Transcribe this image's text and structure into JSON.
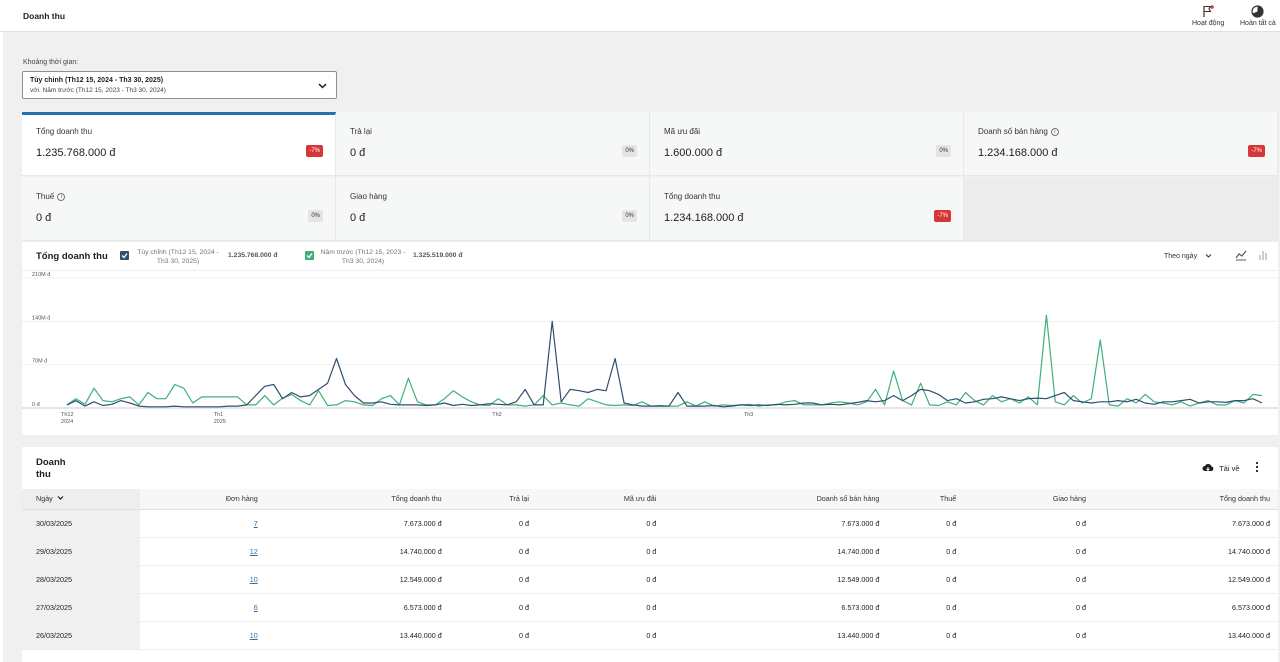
{
  "header": {
    "title": "Doanh thu",
    "activity_label": "Hoạt động",
    "finish_label": "Hoàn tất cà"
  },
  "period": {
    "label": "Khoảng thời gian:",
    "current": "Tùy chỉnh (Th12 15, 2024 - Th3 30, 2025)",
    "compare": "với. Năm trước (Th12 15, 2023 - Th3 30, 2024)"
  },
  "metrics": [
    {
      "label": "Tổng doanh thu",
      "value": "1.235.768.000 đ",
      "delta": "-7%",
      "trend": "neg",
      "active": true,
      "info": false
    },
    {
      "label": "Trả lại",
      "value": "0 đ",
      "delta": "0%",
      "trend": "zero",
      "active": false,
      "info": false
    },
    {
      "label": "Mã ưu đãi",
      "value": "1.600.000 đ",
      "delta": "0%",
      "trend": "zero",
      "active": false,
      "info": false
    },
    {
      "label": "Doanh số bán hàng",
      "value": "1.234.168.000 đ",
      "delta": "-7%",
      "trend": "neg",
      "active": false,
      "info": true
    },
    {
      "label": "Thuế",
      "value": "0 đ",
      "delta": "0%",
      "trend": "zero",
      "active": false,
      "info": true
    },
    {
      "label": "Giao hàng",
      "value": "0 đ",
      "delta": "0%",
      "trend": "zero",
      "active": false,
      "info": false
    },
    {
      "label": "Tổng doanh thu",
      "value": "1.234.168.000 đ",
      "delta": "-7%",
      "trend": "neg",
      "active": false,
      "info": false
    }
  ],
  "chart": {
    "title": "Tổng doanh thu",
    "legend": [
      {
        "name": "Tùy chỉnh (Th12 15, 2024 - Th3 30, 2025)",
        "amount": "1.235.768.000 đ",
        "color": "#2f4f6f"
      },
      {
        "name": "Năm trước (Th12 15, 2023 - Th3 30, 2024)",
        "amount": "1.325.519.000 đ",
        "color": "#40b07a"
      }
    ],
    "interval_label": "Theo ngày"
  },
  "chart_data": {
    "type": "line",
    "y_ticks": [
      "210M đ",
      "140M đ",
      "70M đ",
      "0 đ"
    ],
    "ylim": [
      0,
      210
    ],
    "x_ticks": [
      {
        "line1": "Th12",
        "line2": "2024",
        "day": 0
      },
      {
        "line1": "Th1",
        "line2": "2025",
        "day": 17
      },
      {
        "line1": "Th2",
        "line2": "",
        "day": 48
      },
      {
        "line1": "Th3",
        "line2": "",
        "day": 76
      }
    ],
    "grid": true,
    "series": [
      {
        "name": "Tùy chỉnh (Th12 15, 2024 - Th3 30, 2025)",
        "color": "#2f4f6f",
        "values": [
          5,
          12,
          3,
          10,
          4,
          6,
          12,
          8,
          3,
          2,
          2,
          2,
          3,
          2,
          2,
          2,
          2,
          2,
          3,
          3,
          5,
          20,
          35,
          38,
          15,
          25,
          18,
          20,
          30,
          40,
          80,
          38,
          20,
          8,
          8,
          10,
          6,
          5,
          5,
          5,
          4,
          5,
          8,
          4,
          6,
          4,
          5,
          7,
          6,
          5,
          10,
          30,
          5,
          5,
          140,
          10,
          30,
          28,
          25,
          30,
          28,
          80,
          8,
          5,
          3,
          3,
          3,
          3,
          25,
          3,
          3,
          3,
          4,
          2,
          3,
          5,
          4,
          5,
          4,
          6,
          5,
          6,
          8,
          8,
          5,
          6,
          5,
          7,
          9,
          12,
          10,
          12,
          20,
          12,
          20,
          30,
          28,
          22,
          12,
          15,
          8,
          10,
          14,
          15,
          18,
          15,
          12,
          15,
          16,
          15,
          20,
          25,
          12,
          10,
          8,
          10,
          10,
          12,
          10,
          14,
          8,
          6,
          10,
          10,
          12,
          14,
          8,
          10,
          10,
          9,
          12,
          12,
          15,
          8
        ]
      },
      {
        "name": "Năm trước (Th12 15, 2023 - Th3 30, 2024)",
        "color": "#40b07a",
        "values": [
          5,
          15,
          6,
          32,
          12,
          10,
          15,
          18,
          5,
          25,
          15,
          15,
          38,
          32,
          8,
          18,
          18,
          18,
          18,
          18,
          5,
          5,
          20,
          5,
          16,
          22,
          12,
          5,
          28,
          4,
          5,
          12,
          10,
          5,
          4,
          15,
          20,
          5,
          48,
          10,
          5,
          5,
          15,
          28,
          18,
          10,
          5,
          4,
          15,
          5,
          5,
          3,
          5,
          20,
          5,
          8,
          5,
          3,
          15,
          10,
          5,
          4,
          5,
          4,
          10,
          3,
          4,
          3,
          3,
          10,
          3,
          10,
          3,
          5,
          4,
          5,
          6,
          3,
          5,
          5,
          10,
          12,
          5,
          5,
          5,
          8,
          10,
          8,
          5,
          10,
          30,
          5,
          60,
          12,
          5,
          40,
          5,
          4,
          10,
          5,
          25,
          12,
          5,
          20,
          10,
          15,
          8,
          18,
          5,
          150,
          10,
          5,
          20,
          8,
          15,
          110,
          5,
          3,
          15,
          8,
          22,
          10,
          8,
          5,
          10,
          3,
          8,
          12,
          5,
          5,
          12,
          8,
          22,
          20
        ]
      }
    ]
  },
  "table": {
    "title": "Doanh thu",
    "download_label": "Tải về",
    "headers": [
      "Ngày",
      "Đơn hàng",
      "Tổng doanh thu",
      "Trả lại",
      "Mã ưu đãi",
      "Doanh số bán hàng",
      "Thuế",
      "Giao hàng",
      "Tổng doanh thu"
    ],
    "rows": [
      [
        "30/03/2025",
        "7",
        "7.673.000 đ",
        "0 đ",
        "0 đ",
        "7.673.000 đ",
        "0 đ",
        "0 đ",
        "7.673.000 đ"
      ],
      [
        "29/03/2025",
        "12",
        "14.740.000 đ",
        "0 đ",
        "0 đ",
        "14.740.000 đ",
        "0 đ",
        "0 đ",
        "14.740.000 đ"
      ],
      [
        "28/03/2025",
        "10",
        "12.549.000 đ",
        "0 đ",
        "0 đ",
        "12.549.000 đ",
        "0 đ",
        "0 đ",
        "12.549.000 đ"
      ],
      [
        "27/03/2025",
        "6",
        "6.573.000 đ",
        "0 đ",
        "0 đ",
        "6.573.000 đ",
        "0 đ",
        "0 đ",
        "6.573.000 đ"
      ],
      [
        "26/03/2025",
        "10",
        "13.440.000 đ",
        "0 đ",
        "0 đ",
        "13.440.000 đ",
        "0 đ",
        "0 đ",
        "13.440.000 đ"
      ]
    ]
  }
}
